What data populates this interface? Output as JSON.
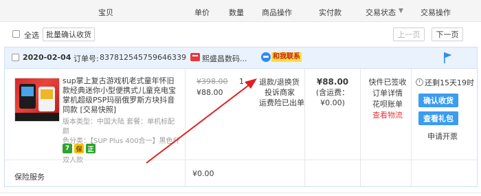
{
  "header": {
    "col_item": "宝贝",
    "col_unit_price": "单价",
    "col_quantity": "数量",
    "col_item_ops": "商品操作",
    "col_paid": "实付款",
    "col_status": "交易状态",
    "col_status_caret": "▼",
    "col_trade_ops": "交易操作"
  },
  "toolbar": {
    "select_all_label": "全选",
    "batch_confirm_label": "批量确认收货",
    "prev_label": "上一页",
    "next_label": "下一页"
  },
  "order": {
    "date": "2020-02-04",
    "order_no_label": "订单号:",
    "order_no": "837812545759646339",
    "shop_name": "熙盛昌数码...",
    "contact_label": "和我联系",
    "item": {
      "title": "sup掌上复古游戏机老式童年怀旧款经典迷你小型便携式儿童充电宝掌机超级PSP玛丽俄罗斯方块抖音同款 [交易快照]",
      "spec_line1": "版本类型：中国大陆  套餐：单机标配  颜",
      "spec_line2": "色分类：【SUP Plus 400合一】黑色升级",
      "spec_line3": "双人款",
      "tags": [
        "7",
        "保",
        "正"
      ],
      "price_original": "¥398.00",
      "price_now": "¥88.00",
      "quantity": "1",
      "ops": [
        "退款/退换货",
        "投诉商家",
        "运费险已出单"
      ]
    },
    "paid": {
      "amount": "¥88.00",
      "shipping": "(含运费：¥0.00)"
    },
    "status": {
      "line1": "快件已签收",
      "line2": "订单详情",
      "line3": "花呗账单",
      "line4": "查看物流"
    },
    "actions": {
      "remaining": "还剩15天19时",
      "confirm_label": "确认收货",
      "gift_label": "查看礼包",
      "invoice_label": "申请开票"
    },
    "insurance": {
      "label": "保险服务",
      "price": "¥0.00"
    }
  },
  "colors": {
    "accent_blue": "#3b9cf0",
    "accent_red": "#e4393c",
    "tag_green": "#2ea12e",
    "tag_yellow": "#f5c400"
  }
}
